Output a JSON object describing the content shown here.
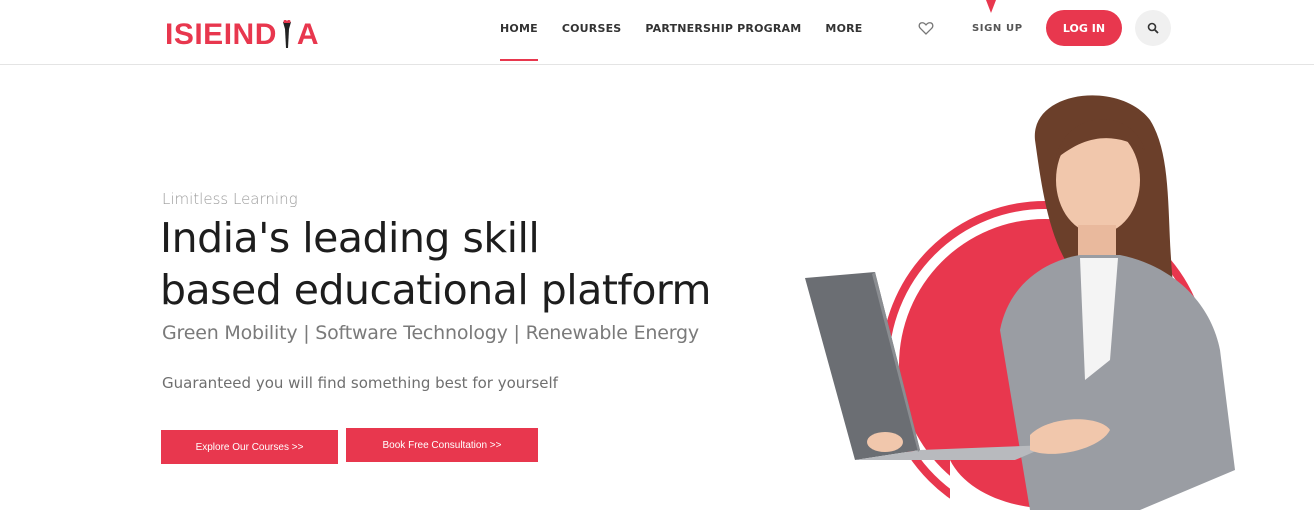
{
  "header": {
    "logo_text_left": "ISIEIND",
    "logo_text_right": "A",
    "nav": [
      {
        "label": "HOME",
        "active": true
      },
      {
        "label": "COURSES",
        "active": false
      },
      {
        "label": "PARTNERSHIP PROGRAM",
        "active": false
      },
      {
        "label": "MORE",
        "active": false
      }
    ],
    "wishlist_icon": "heart-icon",
    "signup_label": "SIGN UP",
    "login_label": "LOG IN",
    "search_icon": "search-icon"
  },
  "hero": {
    "eyebrow": "Limitless Learning",
    "headline_line1": "India's leading skill",
    "headline_line2": "based educational platform",
    "subline": "Green Mobility | Software Technology | Renewable Energy",
    "tagline": "Guaranteed you will find something best for yourself",
    "primary_button": "Explore Our Courses >>",
    "secondary_button": "Book Free Consultation >>"
  },
  "colors": {
    "accent": "#e8374e",
    "text_dark": "#1d1d1d",
    "text_muted": "#7a7a7a"
  }
}
